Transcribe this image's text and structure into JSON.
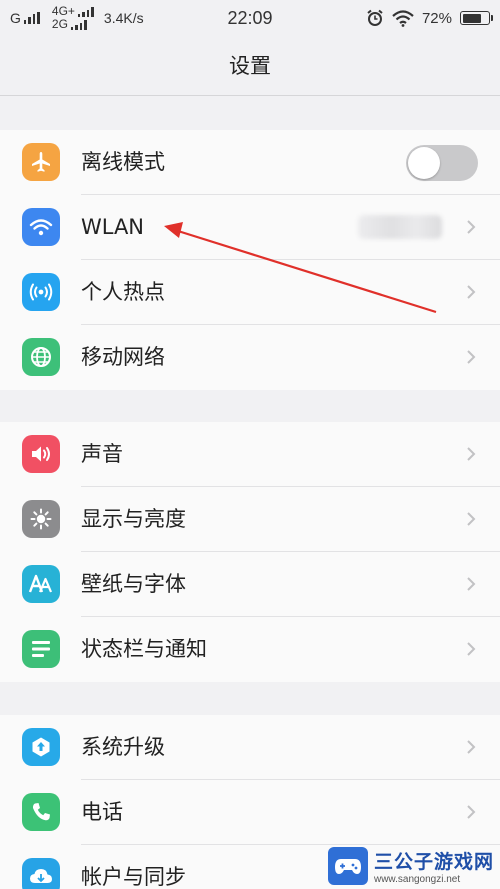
{
  "status_bar": {
    "carrier_1": "G",
    "network_4g": "4G+",
    "network_2g": "2G",
    "speed": "3.4K/s",
    "time": "22:09",
    "battery": "72%",
    "battery_level": 0.72
  },
  "header": {
    "title": "设置"
  },
  "groups": [
    {
      "items": [
        {
          "label": "离线模式",
          "icon": "airplane-icon",
          "color": "#f5a442",
          "control": "toggle",
          "toggle_on": false
        },
        {
          "label": "WLAN",
          "icon": "wifi-icon",
          "color": "#3d87f0",
          "control": "chevron"
        },
        {
          "label": "个人热点",
          "icon": "hotspot-icon",
          "color": "#25a4f0",
          "control": "chevron"
        },
        {
          "label": "移动网络",
          "icon": "globe-icon",
          "color": "#3dc079",
          "control": "chevron"
        }
      ]
    },
    {
      "items": [
        {
          "label": "声音",
          "icon": "speaker-icon",
          "color": "#f15063",
          "control": "chevron"
        },
        {
          "label": "显示与亮度",
          "icon": "brightness-icon",
          "color": "#8c8c8e",
          "control": "chevron"
        },
        {
          "label": "壁纸与字体",
          "icon": "font-icon",
          "color": "#27b2d6",
          "control": "chevron"
        },
        {
          "label": "状态栏与通知",
          "icon": "notification-list-icon",
          "color": "#3dbf78",
          "control": "chevron"
        }
      ]
    },
    {
      "items": [
        {
          "label": "系统升级",
          "icon": "upgrade-icon",
          "color": "#27a9e8",
          "control": "chevron"
        },
        {
          "label": "电话",
          "icon": "phone-icon",
          "color": "#3cc276",
          "control": "chevron"
        },
        {
          "label": "帐户与同步",
          "icon": "cloud-sync-icon",
          "color": "#27a3e6",
          "control": "chevron"
        }
      ]
    }
  ],
  "annotation": {
    "color": "#e0302a"
  },
  "watermark": {
    "title": "三公子游戏网",
    "url": "www.sangongzi.net"
  }
}
